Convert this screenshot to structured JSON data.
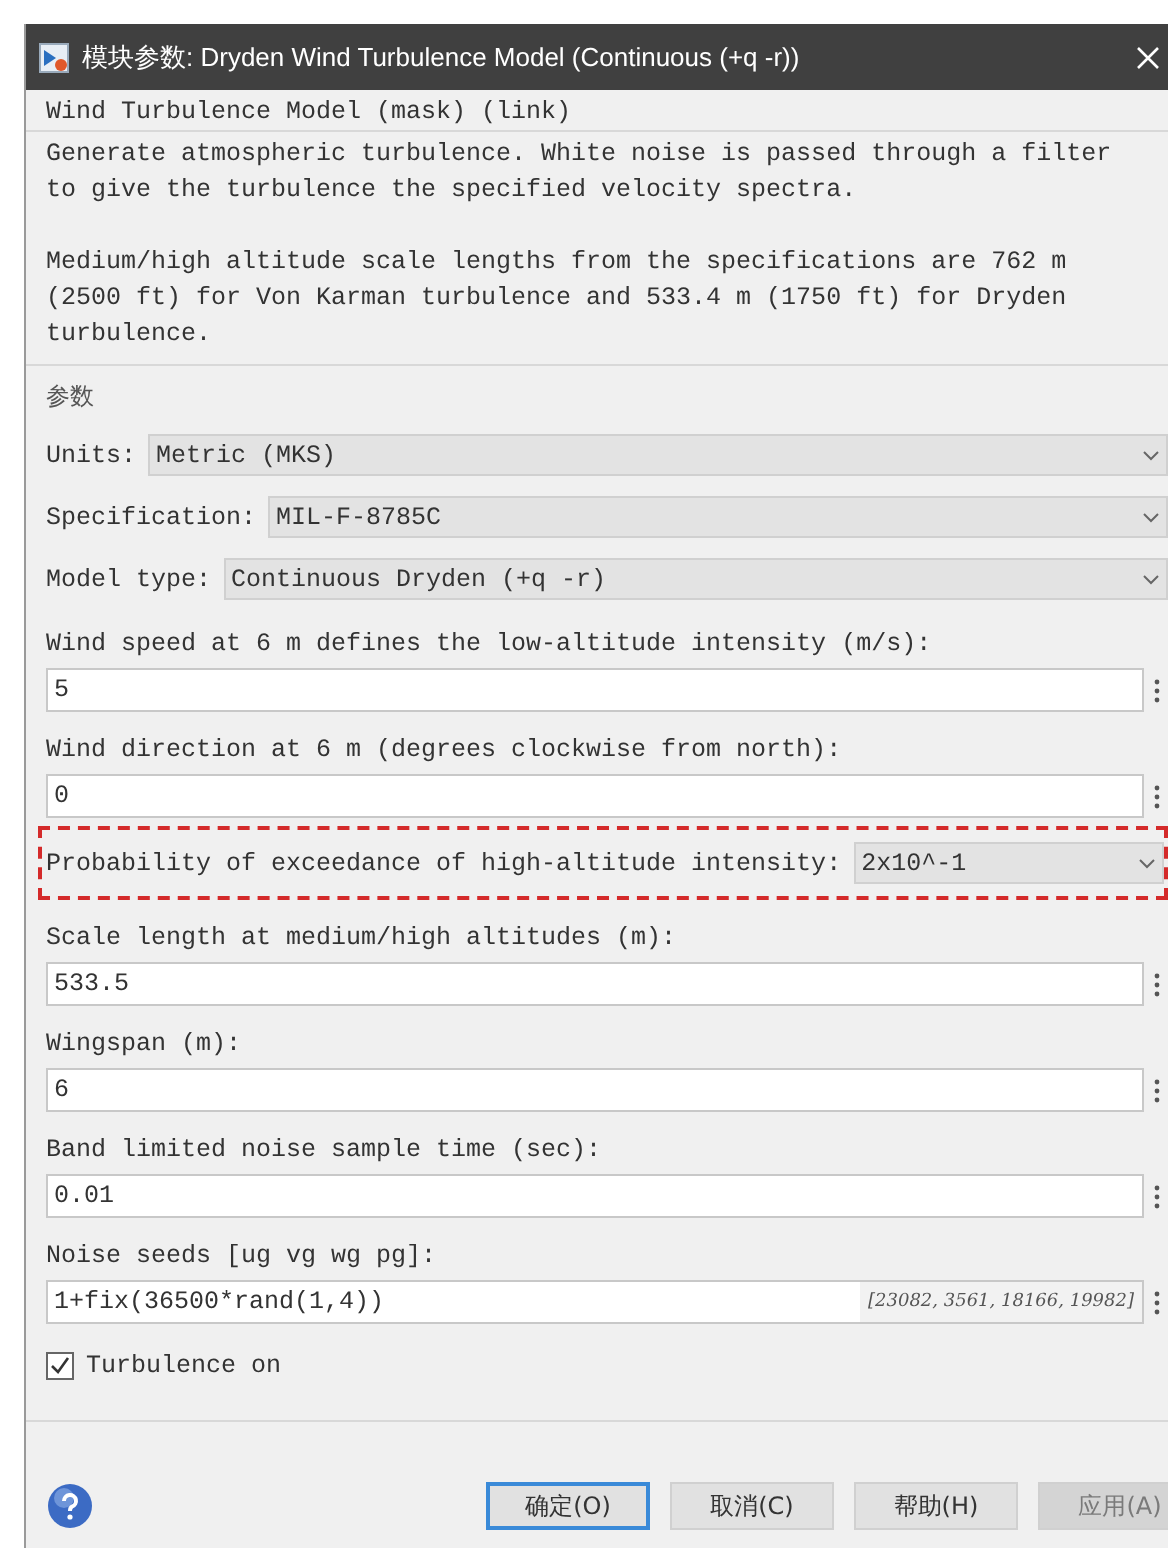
{
  "window": {
    "title": "模块参数: Dryden Wind Turbulence Model (Continuous (+q -r))"
  },
  "header": "Wind Turbulence Model (mask) (link)",
  "description": [
    "Generate atmospheric turbulence. White noise is passed through a filter to give the turbulence the specified velocity spectra.",
    "Medium/high altitude scale lengths from the specifications are 762 m (2500 ft) for Von Karman turbulence and 533.4 m (1750 ft) for Dryden turbulence."
  ],
  "section_title": "参数",
  "parameters": [
    {
      "kind": "dropdown",
      "label": "Units:",
      "value": "Metric (MKS)",
      "highlighted": false
    },
    {
      "kind": "dropdown",
      "label": "Specification:",
      "value": "MIL-F-8785C",
      "highlighted": false
    },
    {
      "kind": "dropdown",
      "label": "Model type:",
      "value": "Continuous Dryden (+q -r)",
      "highlighted": false
    },
    {
      "kind": "field",
      "label": "Wind speed at 6 m defines the low-altitude intensity (m/s):",
      "value": "5",
      "highlighted": false
    },
    {
      "kind": "field",
      "label": "Wind direction at 6 m (degrees clockwise from north):",
      "value": "0",
      "highlighted": false
    },
    {
      "kind": "dropdown",
      "label": "Probability of exceedance of high-altitude intensity:",
      "value": "2x10^-1",
      "highlighted": true
    },
    {
      "kind": "field",
      "label": "Scale length at medium/high altitudes (m):",
      "value": "533.5",
      "highlighted": false
    },
    {
      "kind": "field",
      "label": "Wingspan (m):",
      "value": "6",
      "highlighted": false
    },
    {
      "kind": "field",
      "label": "Band limited noise sample time (sec):",
      "value": "0.01",
      "highlighted": false
    },
    {
      "kind": "field",
      "label": "Noise seeds [ug vg wg pg]:",
      "value": "1+fix(36500*rand(1,4))",
      "evaluated_value": "[23082, 3561, 18166, 19982]",
      "highlighted": false
    },
    {
      "kind": "checkbox",
      "label": "Turbulence on",
      "checked": true,
      "highlighted": false
    }
  ],
  "buttons": [
    {
      "label": "确定(O)",
      "default": true,
      "disabled": false
    },
    {
      "label": "取消(C)",
      "default": false,
      "disabled": false
    },
    {
      "label": "帮助(H)",
      "default": false,
      "disabled": false
    },
    {
      "label": "应用(A)",
      "default": false,
      "disabled": true
    }
  ]
}
